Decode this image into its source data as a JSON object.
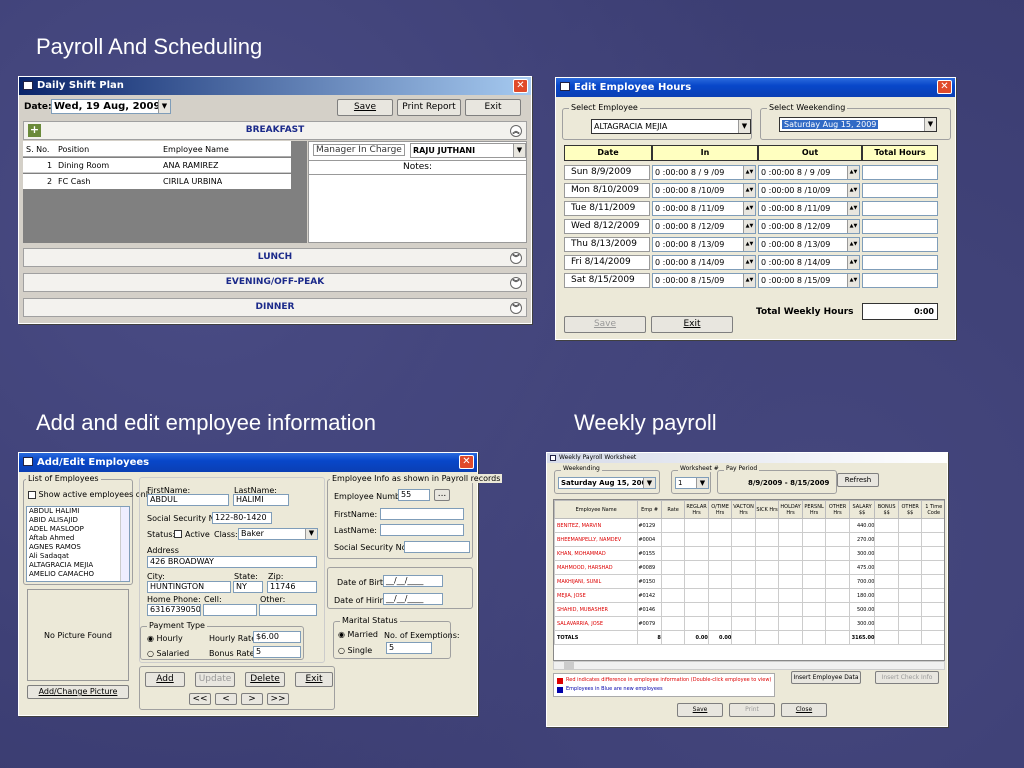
{
  "headings": {
    "s1": "Payroll And Scheduling",
    "s2": "Add and edit employee information",
    "s3": "Weekly payroll"
  },
  "shift": {
    "title": "Daily Shift Plan",
    "date_label": "Date:",
    "date_value": "Wed, 19 Aug, 2009",
    "save": "Save",
    "print": "Print Report",
    "exit": "Exit",
    "breakfast": "BREAKFAST",
    "cols": [
      "S. No.",
      "Position",
      "Employee Name"
    ],
    "rows": [
      {
        "no": "1",
        "pos": "Dining Room",
        "emp": "ANA RAMIREZ"
      },
      {
        "no": "2",
        "pos": "FC Cash",
        "emp": "CIRILA URBINA"
      }
    ],
    "manager_label": "Manager In Charge",
    "manager_value": "RAJU JUTHANI",
    "notes_label": "Notes:",
    "lunch": "LUNCH",
    "evening": "EVENING/OFF-PEAK",
    "dinner": "DINNER"
  },
  "hours": {
    "title": "Edit Employee Hours",
    "select_emp_label": "Select Employee",
    "emp_value": "ALTAGRACIA MEJIA",
    "select_week_label": "Select Weekending",
    "week_value": "Saturday  Aug 15, 2009",
    "cols": [
      "Date",
      "In",
      "Out",
      "Total Hours"
    ],
    "rows": [
      {
        "d": "Sun  8/9/2009",
        "i": "0 :00:00  8 / 9 /09",
        "o": "0 :00:00  8 / 9 /09"
      },
      {
        "d": "Mon  8/10/2009",
        "i": "0 :00:00  8 /10/09",
        "o": "0 :00:00  8 /10/09"
      },
      {
        "d": "Tue  8/11/2009",
        "i": "0 :00:00  8 /11/09",
        "o": "0 :00:00  8 /11/09"
      },
      {
        "d": "Wed  8/12/2009",
        "i": "0 :00:00  8 /12/09",
        "o": "0 :00:00  8 /12/09"
      },
      {
        "d": "Thu  8/13/2009",
        "i": "0 :00:00  8 /13/09",
        "o": "0 :00:00  8 /13/09"
      },
      {
        "d": "Fri  8/14/2009",
        "i": "0 :00:00  8 /14/09",
        "o": "0 :00:00  8 /14/09"
      },
      {
        "d": "Sat  8/15/2009",
        "i": "0 :00:00  8 /15/09",
        "o": "0 :00:00  8 /15/09"
      }
    ],
    "total_label": "Total Weekly Hours",
    "total_value": "0:00",
    "save": "Save",
    "exit": "Exit"
  },
  "addedit": {
    "title": "Add/Edit Employees",
    "list_label": "List of Employees",
    "show_active": "Show active employees only",
    "list": [
      "ABDUL HALIMI",
      "ABID  ALISAJID",
      "ADEL MASLOOP",
      "Aftab Ahmed",
      "AGNES RAMOS",
      "Ali Sadaqat",
      "ALTAGRACIA MEJIA",
      "AMELIO CAMACHO"
    ],
    "no_picture": "No Picture Found",
    "add_change_pic": "Add/Change Picture",
    "first_label": "FirstName:",
    "last_label": "LastName:",
    "first": "ABDUL",
    "last": "HALIMI",
    "ssn_label": "Social Security No.:",
    "ssn": "122-80-1420",
    "status_label": "Status:",
    "active_label": "Active",
    "class_label": "Class:",
    "class_value": "Baker",
    "address_label": "Address",
    "address": "426 BROADWAY",
    "city_label": "City:",
    "state_label": "State:",
    "zip_label": "Zip:",
    "city": "HUNTINGTON",
    "state": "NY",
    "zip": "11746",
    "home_label": "Home Phone:",
    "cell_label": "Cell:",
    "other_label": "Other:",
    "home": "6316739050",
    "pay_label": "Payment Type",
    "hourly": "Hourly",
    "salaried": "Salaried",
    "rate_label": "Hourly Rate:",
    "rate": "$6.00",
    "bonus_label": "Bonus Rate:",
    "bonus": "5",
    "add": "Add",
    "update": "Update",
    "delete": "Delete",
    "exit": "Exit",
    "nav": [
      "<<",
      "<",
      ">",
      ">>"
    ],
    "info_label": "Employee Info as shown in Payroll records",
    "empno_label": "Employee Number:",
    "empno": "55",
    "fn2": "FirstName:",
    "ln2": "LastName:",
    "ssn2": "Social Security No.:",
    "dob_label": "Date of Birth:",
    "dob": "__/__/____",
    "doh_label": "Date of Hiring:",
    "doh": "__/__/____",
    "marital_label": "Marital Status",
    "married": "Married",
    "single": "Single",
    "exempt_label": "No. of Exemptions:",
    "exempt": "5"
  },
  "weekly": {
    "title": "Weekly Payroll Worksheet",
    "weekending_label": "Weekending",
    "weekending": "Saturday  Aug 15, 2009",
    "worksheet_label": "Worksheet #",
    "worksheet": "1",
    "period_label": "Pay Period",
    "period": "8/9/2009 - 8/15/2009",
    "refresh": "Refresh",
    "cols": [
      "Employee Name",
      "Emp #",
      "Rate",
      "REGLAR Hrs",
      "O/TIME Hrs",
      "VACTON Hrs",
      "SICK Hrs",
      "HOLDAY Hrs",
      "PERSNL Hrs",
      "OTHER Hrs",
      "SALARY $$",
      "BONUS $$",
      "OTHER $$",
      "1 Time Code"
    ],
    "rows": [
      {
        "n": "BENITEZ, MARVIN",
        "e": "#0129",
        "s": "440.00"
      },
      {
        "n": "BHEEMANPELLY, NAMDEV",
        "e": "#0004",
        "s": "270.00"
      },
      {
        "n": "KHAN, MOHAMMAD",
        "e": "#0155",
        "s": "300.00"
      },
      {
        "n": "MAHMOOD, HARSHAD",
        "e": "#0089",
        "s": "475.00"
      },
      {
        "n": "MAKHIJANI, SUNIL",
        "e": "#0150",
        "s": "700.00"
      },
      {
        "n": "MEJIA, JOSE",
        "e": "#0142",
        "s": "180.00"
      },
      {
        "n": "SHAHID, MUBASHER",
        "e": "#0146",
        "s": "500.00"
      },
      {
        "n": "SALAVARRIA, JOSE",
        "e": "#0079",
        "s": "300.00"
      }
    ],
    "totals": {
      "n": "TOTALS",
      "e": "8",
      "r": "0.00",
      "o": "0.00",
      "s": "3165.00"
    },
    "legend_red": "Red indicates difference in employee information (Double-click employee to view)",
    "legend_blue": "Employees in Blue are new employees",
    "insert": "Insert Employee Data",
    "insert_check": "Insert Check Info",
    "save": "Save",
    "print": "Print",
    "close": "Close"
  }
}
